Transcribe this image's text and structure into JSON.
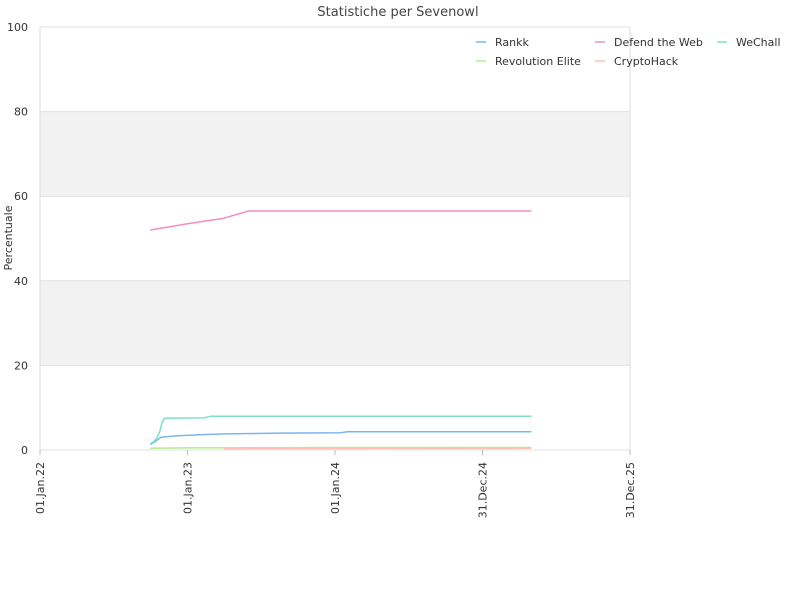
{
  "chart_data": {
    "type": "line",
    "title": "Statistiche per Sevenowl",
    "xlabel": "",
    "ylabel": "Percentuale",
    "ylim": [
      0,
      100
    ],
    "xlim": [
      "2022-01-01",
      "2025-12-31"
    ],
    "x_ticks": [
      "01.Jan.22",
      "01.Jan.23",
      "01.Jan.24",
      "31.Dec.24",
      "31.Dec.25"
    ],
    "x_tick_dates": [
      "2022-01-01",
      "2023-01-01",
      "2024-01-01",
      "2024-12-31",
      "2025-12-31"
    ],
    "y_ticks": [
      0,
      20,
      40,
      60,
      80,
      100
    ],
    "grid": true,
    "alternating_bands": true,
    "legend_position": "top-right",
    "legend": [
      "Rankk",
      "Defend the Web",
      "WeChall",
      "Revolution Elite",
      "CryptoHack"
    ],
    "series": [
      {
        "name": "Rankk",
        "color": "#7cb5ec",
        "points": [
          [
            "2022-10-01",
            1.3
          ],
          [
            "2022-10-10",
            1.8
          ],
          [
            "2022-10-20",
            2.5
          ],
          [
            "2022-10-28",
            3.0
          ],
          [
            "2022-11-15",
            3.2
          ],
          [
            "2022-12-15",
            3.4
          ],
          [
            "2023-02-01",
            3.6
          ],
          [
            "2023-04-01",
            3.8
          ],
          [
            "2023-08-15",
            4.0
          ],
          [
            "2024-01-15",
            4.1
          ],
          [
            "2024-02-01",
            4.3
          ],
          [
            "2025-05-01",
            4.3
          ]
        ]
      },
      {
        "name": "Defend the Web",
        "color": "#f28fc2",
        "points": [
          [
            "2022-10-01",
            52.0
          ],
          [
            "2023-01-01",
            53.5
          ],
          [
            "2023-04-01",
            54.8
          ],
          [
            "2023-06-01",
            56.5
          ],
          [
            "2025-05-01",
            56.5
          ]
        ]
      },
      {
        "name": "WeChall",
        "color": "#7fe0c3",
        "points": [
          [
            "2022-10-01",
            1.5
          ],
          [
            "2022-10-10",
            2.0
          ],
          [
            "2022-10-18",
            3.0
          ],
          [
            "2022-10-25",
            4.5
          ],
          [
            "2022-10-30",
            6.5
          ],
          [
            "2022-11-05",
            7.5
          ],
          [
            "2023-02-10",
            7.6
          ],
          [
            "2023-03-01",
            8.0
          ],
          [
            "2025-05-01",
            8.0
          ]
        ]
      },
      {
        "name": "Revolution Elite",
        "color": "#b5ec8f",
        "points": [
          [
            "2022-10-01",
            0.4
          ],
          [
            "2023-01-01",
            0.5
          ],
          [
            "2024-01-01",
            0.6
          ],
          [
            "2025-05-01",
            0.6
          ]
        ]
      },
      {
        "name": "CryptoHack",
        "color": "#f7c3b8",
        "points": [
          [
            "2023-04-01",
            0.3
          ],
          [
            "2025-05-01",
            0.4
          ]
        ]
      }
    ]
  }
}
